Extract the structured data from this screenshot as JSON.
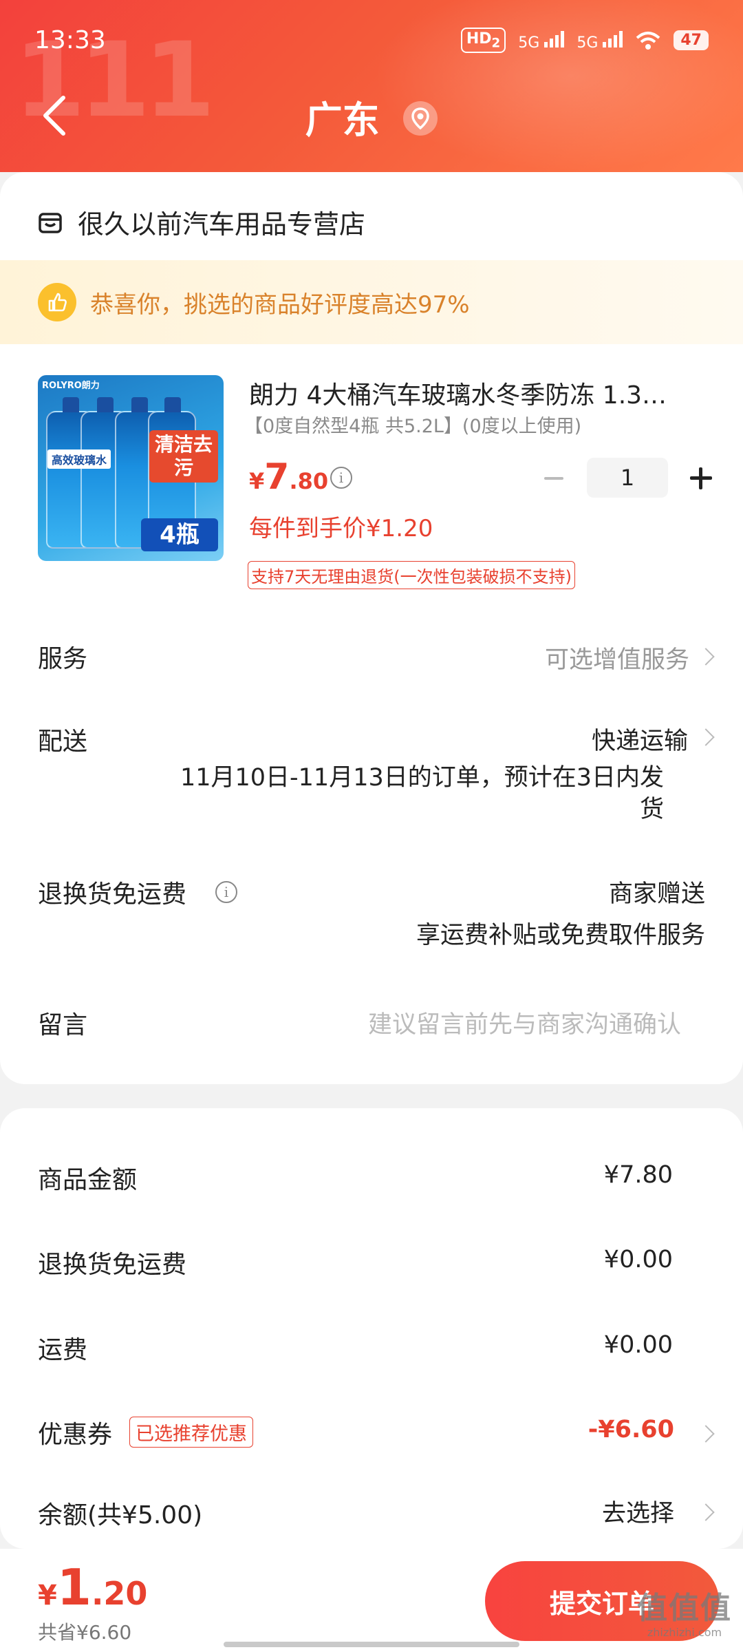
{
  "status_bar": {
    "time": "13:33",
    "hd": "HD",
    "hd_sub": "2",
    "signal1": "5G",
    "signal2": "5G",
    "battery": "47"
  },
  "header": {
    "title": "广东",
    "back_icon": "chevron-left-icon",
    "location_icon": "location-pin-icon"
  },
  "store": {
    "icon": "store-icon",
    "name": "很久以前汽车用品专营店"
  },
  "banner": {
    "icon": "thumbs-up-icon",
    "text": "恭喜你，挑选的商品好评度高达97%"
  },
  "product": {
    "title": "朗力 4大桶汽车玻璃水冬季防冻 1.3…",
    "spec": "【0度自然型4瓶 共5.2L】(0度以上使用)",
    "price_currency": "¥",
    "price_int": "7",
    "price_dec": ".80",
    "quantity": "1",
    "each_price": "每件到手价¥1.20",
    "return_policy": "支持7天无理由退货(一次性包装破损不支持)",
    "image": {
      "brand": "ROLYRO朗力",
      "label": "高效玻璃水",
      "tag": "清洁去污",
      "badge": "4瓶"
    }
  },
  "services": {
    "service_label": "服务",
    "service_value": "可选增值服务",
    "delivery_label": "配送",
    "delivery_value": "快递运输",
    "delivery_note": "11月10日-11月13日的订单，预计在3日内发货",
    "return_label": "退换货免运费",
    "return_value": "商家赠送",
    "return_note": "享运费补贴或免费取件服务",
    "message_label": "留言",
    "message_placeholder": "建议留言前先与商家沟通确认"
  },
  "summary": {
    "goods_label": "商品金额",
    "goods_value": "¥7.80",
    "return_fee_label": "退换货免运费",
    "return_fee_value": "¥0.00",
    "shipping_label": "运费",
    "shipping_value": "¥0.00",
    "coupon_label": "优惠券",
    "coupon_tag": "已选推荐优惠",
    "coupon_value": "-¥6.60",
    "balance_label": "余额(共¥5.00)",
    "balance_value": "去选择"
  },
  "footer": {
    "currency": "¥",
    "total_int": "1",
    "total_dec": ".20",
    "saved": "共省¥6.60",
    "submit_label": "提交订单"
  },
  "watermark": {
    "big": "值值值",
    "small": "zhizhizhi.com"
  },
  "colors": {
    "accent": "#e8412f",
    "banner_text": "#d9822b",
    "banner_bg": "#fff3d8"
  }
}
